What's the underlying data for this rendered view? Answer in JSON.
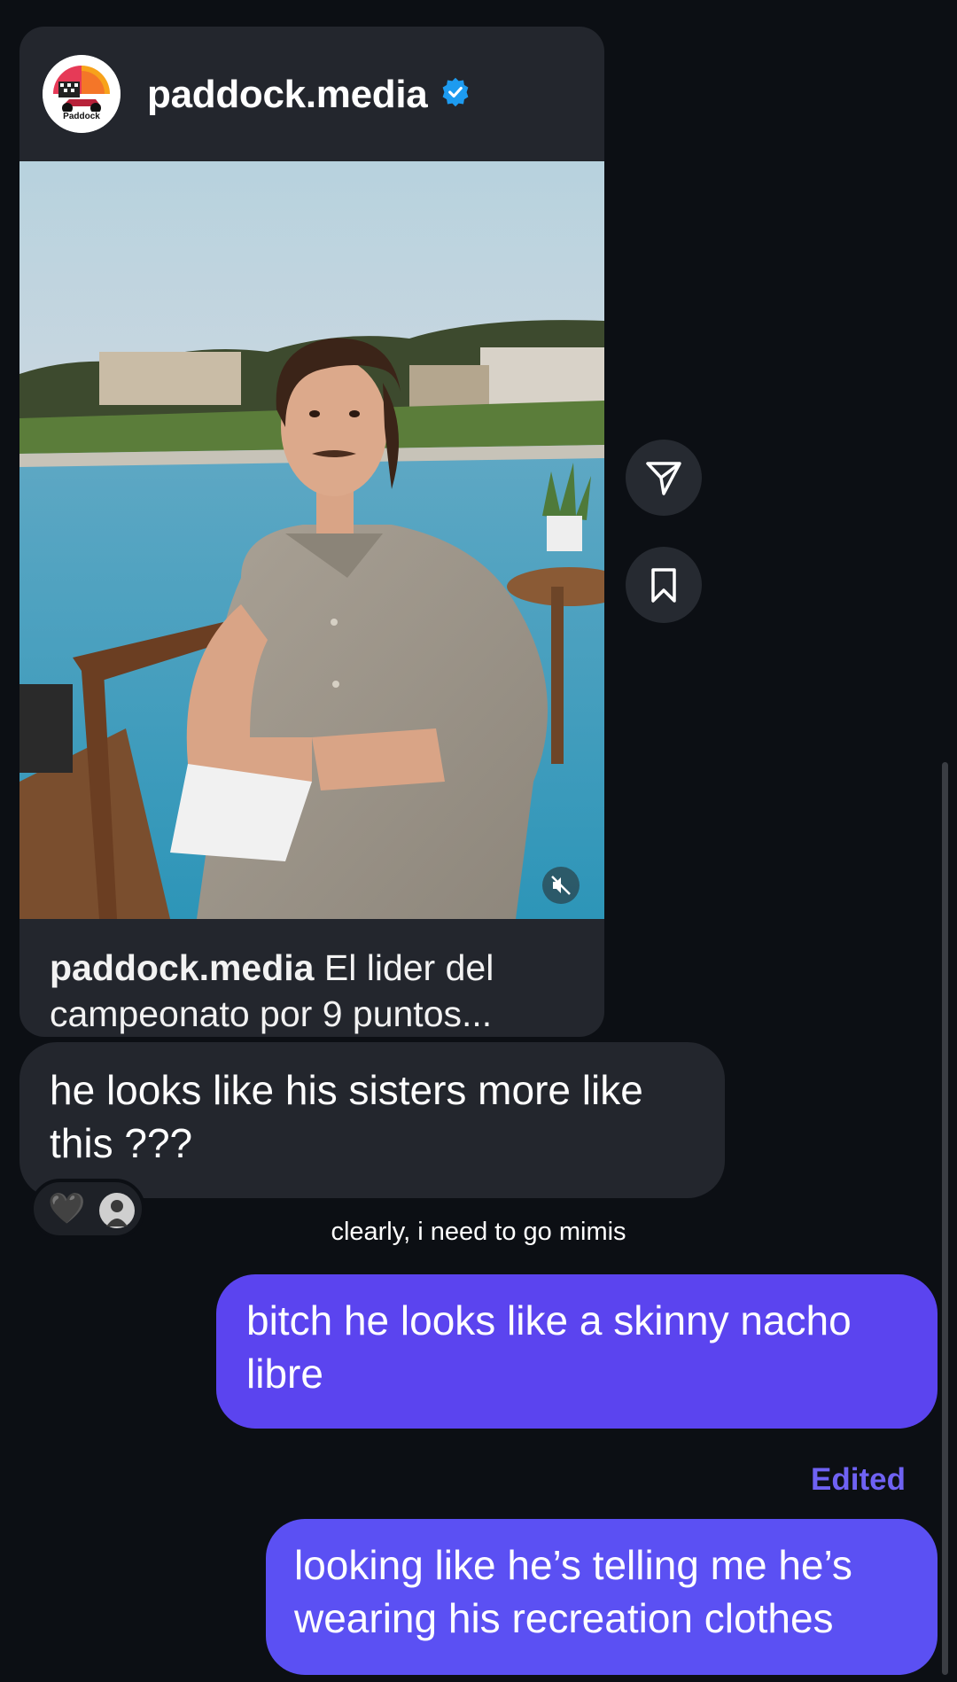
{
  "post": {
    "author": "paddock.media",
    "avatar_label": "Paddock",
    "caption_author": "paddock.media",
    "caption_text": " El lider del campeonato por 9 puntos..."
  },
  "actions": {
    "share_icon": "send-icon",
    "save_icon": "bookmark-icon"
  },
  "messages": [
    {
      "direction": "incoming",
      "text": "he looks like his sisters more like this ???"
    },
    {
      "direction": "outgoing",
      "text": "bitch he looks like a skinny nacho libre"
    },
    {
      "direction": "outgoing",
      "text": "looking like he’s telling me he’s wearing his recreation clothes"
    }
  ],
  "reaction": {
    "emoji": "🖤"
  },
  "overlay_caption": "clearly, i need to go mimis",
  "edited_label": "Edited",
  "colors": {
    "background": "#0c0f14",
    "incoming_bubble": "#23262d",
    "outgoing_bubble": "#5b44ef",
    "verified": "#1d9bf0",
    "edited": "#6f62f3"
  }
}
